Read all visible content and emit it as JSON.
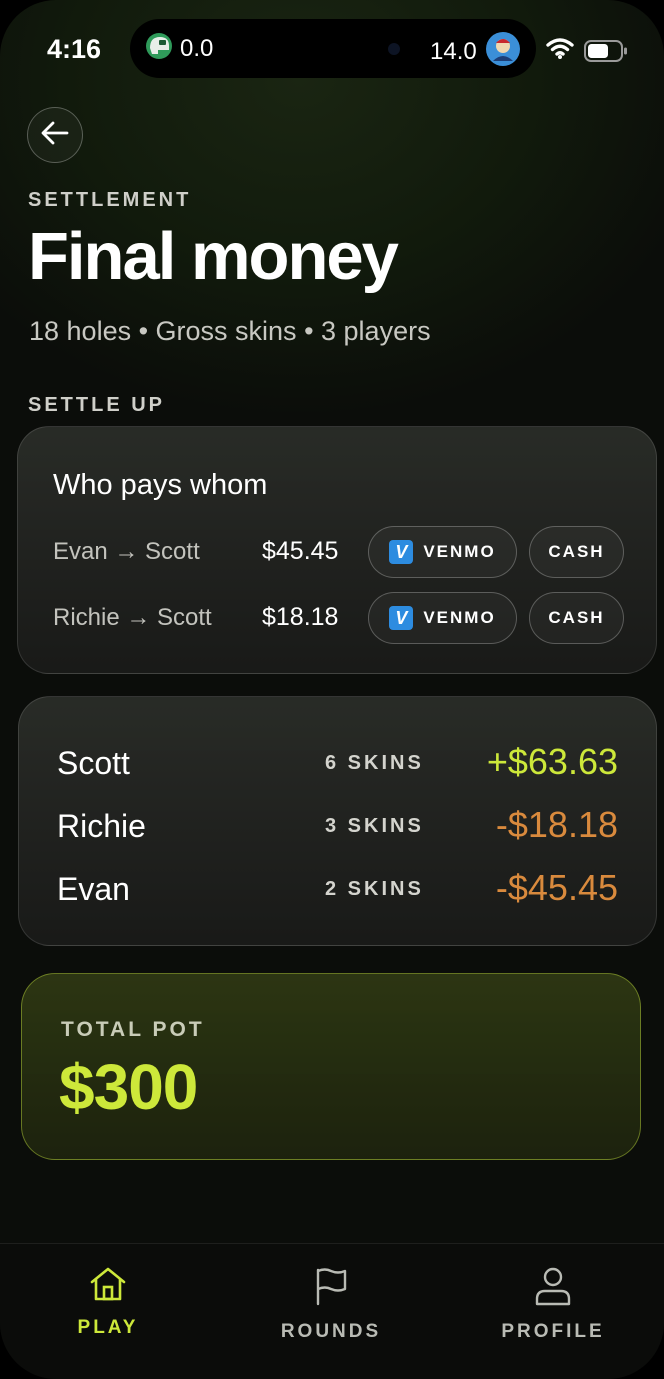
{
  "colors": {
    "accent": "#cde83a",
    "positive": "#cde83a",
    "negative": "#d98a3d",
    "muted": "#8f928a"
  },
  "status_bar": {
    "time": "4:16",
    "left_value": "0.0",
    "right_value": "14.0"
  },
  "header": {
    "back_icon": "arrow-left-icon",
    "eyebrow": "SETTLEMENT",
    "title": "Final money",
    "subtitle": "18 holes • Gross skins • 3 players"
  },
  "settle_up": {
    "section_label": "SETTLE UP",
    "card_title": "Who pays whom",
    "venmo_icon_letter": "V",
    "payments": [
      {
        "who": "Evan → Scott",
        "amount": "$45.45",
        "venmo_label": "VENMO",
        "cash_label": "CASH"
      },
      {
        "who": "Richie → Scott",
        "amount": "$18.18",
        "venmo_label": "VENMO",
        "cash_label": "CASH"
      }
    ]
  },
  "standings": [
    {
      "name": "Scott",
      "skins": "6 SKINS",
      "money": "+$63.63",
      "status": "positive"
    },
    {
      "name": "Richie",
      "skins": "3 SKINS",
      "money": "-$18.18",
      "status": "negative"
    },
    {
      "name": "Evan",
      "skins": "2 SKINS",
      "money": "-$45.45",
      "status": "negative"
    }
  ],
  "pot": {
    "label": "TOTAL POT",
    "value": "$300"
  },
  "tabs": [
    {
      "label": "PLAY",
      "icon": "home-icon",
      "active": true
    },
    {
      "label": "ROUNDS",
      "icon": "flag-icon",
      "active": false
    },
    {
      "label": "PROFILE",
      "icon": "user-icon",
      "active": false
    }
  ]
}
